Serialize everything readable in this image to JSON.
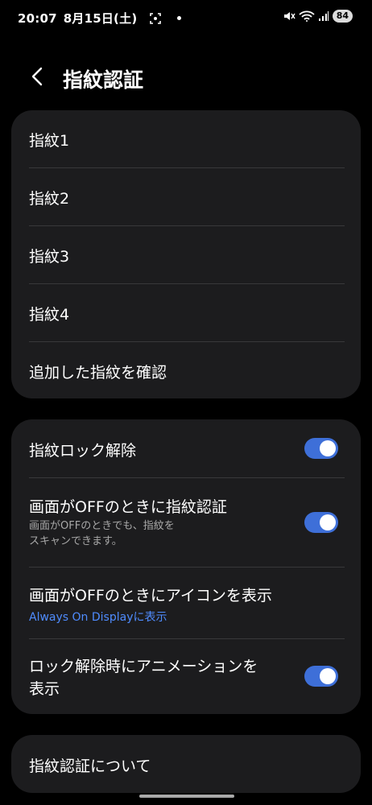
{
  "status_bar": {
    "time": "20:07",
    "date": "8月15日(土)",
    "battery": "84",
    "icons": [
      "screenshot-icon",
      "notification-dot-icon",
      "mute-icon",
      "wifi-icon",
      "signal-icon",
      "battery-icon"
    ]
  },
  "header": {
    "back_icon": "chevron-left-icon",
    "title": "指紋認証"
  },
  "fingerprints_card": {
    "items": [
      {
        "label": "指紋1"
      },
      {
        "label": "指紋2"
      },
      {
        "label": "指紋3"
      },
      {
        "label": "指紋4"
      },
      {
        "label": "追加した指紋を確認"
      }
    ]
  },
  "settings_card": {
    "unlock": {
      "label": "指紋ロック解除",
      "enabled": true
    },
    "screen_off_auth": {
      "label": "画面がOFFのときに指紋認証",
      "sub_line1": "画面がOFFのときでも、指紋を",
      "sub_line2": "スキャンできます。",
      "enabled": true
    },
    "screen_off_icon": {
      "label": "画面がOFFのときにアイコンを表示",
      "link": "Always On Displayに表示"
    },
    "unlock_animation": {
      "label_line1": "ロック解除時にアニメーションを",
      "label_line2": "表示",
      "enabled": true
    }
  },
  "about_card": {
    "label": "指紋認証について"
  },
  "colors": {
    "background": "#000000",
    "card": "#1c1c1e",
    "toggle_on": "#3e6fd8",
    "link": "#4f8cff"
  }
}
